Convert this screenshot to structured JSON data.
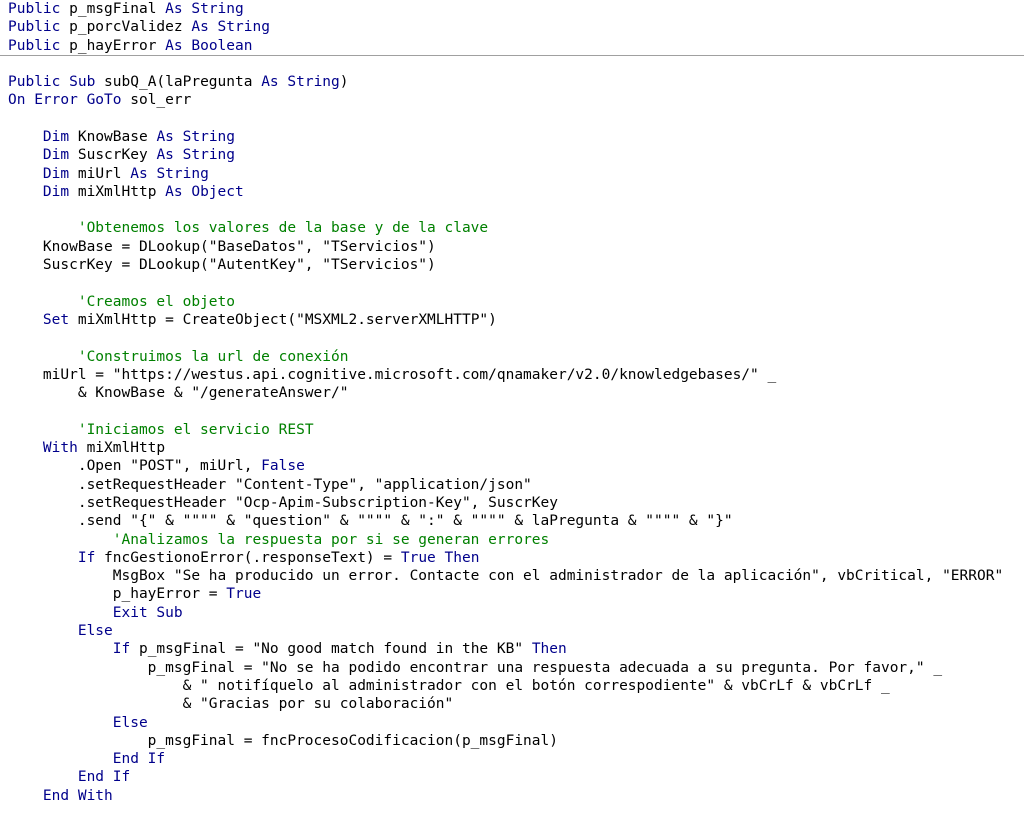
{
  "editor": {
    "colors": {
      "keyword": "#00008b",
      "comment": "#008000",
      "text": "#000000",
      "separator": "#a0a0a0",
      "background": "#ffffff"
    },
    "declarations": [
      [
        {
          "t": "kw",
          "v": "Public"
        },
        {
          "t": "tx",
          "v": " p_msgFinal "
        },
        {
          "t": "kw",
          "v": "As"
        },
        {
          "t": "tx",
          "v": " "
        },
        {
          "t": "kw",
          "v": "String"
        }
      ],
      [
        {
          "t": "kw",
          "v": "Public"
        },
        {
          "t": "tx",
          "v": " p_porcValidez "
        },
        {
          "t": "kw",
          "v": "As"
        },
        {
          "t": "tx",
          "v": " "
        },
        {
          "t": "kw",
          "v": "String"
        }
      ],
      [
        {
          "t": "kw",
          "v": "Public"
        },
        {
          "t": "tx",
          "v": " p_hayError "
        },
        {
          "t": "kw",
          "v": "As"
        },
        {
          "t": "tx",
          "v": " "
        },
        {
          "t": "kw",
          "v": "Boolean"
        }
      ]
    ],
    "procedure": [
      [
        {
          "t": "kw",
          "v": "Public Sub"
        },
        {
          "t": "tx",
          "v": " subQ_A(laPregunta "
        },
        {
          "t": "kw",
          "v": "As"
        },
        {
          "t": "tx",
          "v": " "
        },
        {
          "t": "kw",
          "v": "String"
        },
        {
          "t": "tx",
          "v": ")"
        }
      ],
      [
        {
          "t": "kw",
          "v": "On Error GoTo"
        },
        {
          "t": "tx",
          "v": " sol_err"
        }
      ],
      [],
      [
        {
          "t": "tx",
          "v": "    "
        },
        {
          "t": "kw",
          "v": "Dim"
        },
        {
          "t": "tx",
          "v": " KnowBase "
        },
        {
          "t": "kw",
          "v": "As"
        },
        {
          "t": "tx",
          "v": " "
        },
        {
          "t": "kw",
          "v": "String"
        }
      ],
      [
        {
          "t": "tx",
          "v": "    "
        },
        {
          "t": "kw",
          "v": "Dim"
        },
        {
          "t": "tx",
          "v": " SuscrKey "
        },
        {
          "t": "kw",
          "v": "As"
        },
        {
          "t": "tx",
          "v": " "
        },
        {
          "t": "kw",
          "v": "String"
        }
      ],
      [
        {
          "t": "tx",
          "v": "    "
        },
        {
          "t": "kw",
          "v": "Dim"
        },
        {
          "t": "tx",
          "v": " miUrl "
        },
        {
          "t": "kw",
          "v": "As"
        },
        {
          "t": "tx",
          "v": " "
        },
        {
          "t": "kw",
          "v": "String"
        }
      ],
      [
        {
          "t": "tx",
          "v": "    "
        },
        {
          "t": "kw",
          "v": "Dim"
        },
        {
          "t": "tx",
          "v": " miXmlHttp "
        },
        {
          "t": "kw",
          "v": "As"
        },
        {
          "t": "tx",
          "v": " "
        },
        {
          "t": "kw",
          "v": "Object"
        }
      ],
      [],
      [
        {
          "t": "tx",
          "v": "        "
        },
        {
          "t": "cm",
          "v": "'Obtenemos los valores de la base y de la clave"
        }
      ],
      [
        {
          "t": "tx",
          "v": "    KnowBase = DLookup(\"BaseDatos\", \"TServicios\")"
        }
      ],
      [
        {
          "t": "tx",
          "v": "    SuscrKey = DLookup(\"AutentKey\", \"TServicios\")"
        }
      ],
      [],
      [
        {
          "t": "tx",
          "v": "        "
        },
        {
          "t": "cm",
          "v": "'Creamos el objeto"
        }
      ],
      [
        {
          "t": "tx",
          "v": "    "
        },
        {
          "t": "kw",
          "v": "Set"
        },
        {
          "t": "tx",
          "v": " miXmlHttp = CreateObject(\"MSXML2.serverXMLHTTP\")"
        }
      ],
      [],
      [
        {
          "t": "tx",
          "v": "        "
        },
        {
          "t": "cm",
          "v": "'Construimos la url de conexión"
        }
      ],
      [
        {
          "t": "tx",
          "v": "    miUrl = \"https://westus.api.cognitive.microsoft.com/qnamaker/v2.0/knowledgebases/\" _"
        }
      ],
      [
        {
          "t": "tx",
          "v": "        & KnowBase & \"/generateAnswer/\""
        }
      ],
      [],
      [
        {
          "t": "tx",
          "v": "        "
        },
        {
          "t": "cm",
          "v": "'Iniciamos el servicio REST"
        }
      ],
      [
        {
          "t": "tx",
          "v": "    "
        },
        {
          "t": "kw",
          "v": "With"
        },
        {
          "t": "tx",
          "v": " miXmlHttp"
        }
      ],
      [
        {
          "t": "tx",
          "v": "        .Open \"POST\", miUrl, "
        },
        {
          "t": "kw",
          "v": "False"
        }
      ],
      [
        {
          "t": "tx",
          "v": "        .setRequestHeader \"Content-Type\", \"application/json\""
        }
      ],
      [
        {
          "t": "tx",
          "v": "        .setRequestHeader \"Ocp-Apim-Subscription-Key\", SuscrKey"
        }
      ],
      [
        {
          "t": "tx",
          "v": "        .send \"{\" & \"\"\"\" & \"question\" & \"\"\"\" & \":\" & \"\"\"\" & laPregunta & \"\"\"\" & \"}\""
        }
      ],
      [
        {
          "t": "tx",
          "v": "            "
        },
        {
          "t": "cm",
          "v": "'Analizamos la respuesta por si se generan errores"
        }
      ],
      [
        {
          "t": "tx",
          "v": "        "
        },
        {
          "t": "kw",
          "v": "If"
        },
        {
          "t": "tx",
          "v": " fncGestionoError(.responseText) = "
        },
        {
          "t": "kw",
          "v": "True Then"
        }
      ],
      [
        {
          "t": "tx",
          "v": "            MsgBox \"Se ha producido un error. Contacte con el administrador de la aplicación\", vbCritical, \"ERROR\""
        }
      ],
      [
        {
          "t": "tx",
          "v": "            p_hayError = "
        },
        {
          "t": "kw",
          "v": "True"
        }
      ],
      [
        {
          "t": "tx",
          "v": "            "
        },
        {
          "t": "kw",
          "v": "Exit Sub"
        }
      ],
      [
        {
          "t": "tx",
          "v": "        "
        },
        {
          "t": "kw",
          "v": "Else"
        }
      ],
      [
        {
          "t": "tx",
          "v": "            "
        },
        {
          "t": "kw",
          "v": "If"
        },
        {
          "t": "tx",
          "v": " p_msgFinal = \"No good match found in the KB\" "
        },
        {
          "t": "kw",
          "v": "Then"
        }
      ],
      [
        {
          "t": "tx",
          "v": "                p_msgFinal = \"No se ha podido encontrar una respuesta adecuada a su pregunta. Por favor,\" _"
        }
      ],
      [
        {
          "t": "tx",
          "v": "                    & \" notifíquelo al administrador con el botón correspodiente\" & vbCrLf & vbCrLf _"
        }
      ],
      [
        {
          "t": "tx",
          "v": "                    & \"Gracias por su colaboración\""
        }
      ],
      [
        {
          "t": "tx",
          "v": "            "
        },
        {
          "t": "kw",
          "v": "Else"
        }
      ],
      [
        {
          "t": "tx",
          "v": "                p_msgFinal = fncProcesoCodificacion(p_msgFinal)"
        }
      ],
      [
        {
          "t": "tx",
          "v": "            "
        },
        {
          "t": "kw",
          "v": "End If"
        }
      ],
      [
        {
          "t": "tx",
          "v": "        "
        },
        {
          "t": "kw",
          "v": "End If"
        }
      ],
      [
        {
          "t": "tx",
          "v": "    "
        },
        {
          "t": "kw",
          "v": "End With"
        }
      ]
    ]
  }
}
